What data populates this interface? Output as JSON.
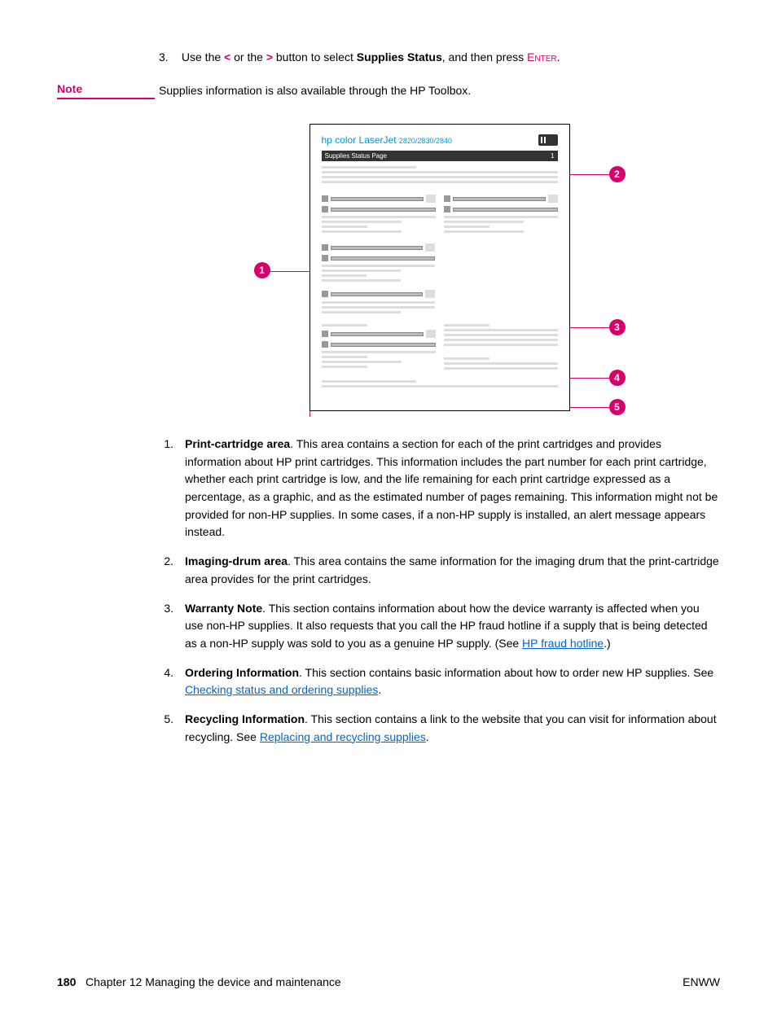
{
  "step": {
    "number": "3.",
    "pre": "Use the ",
    "lt": "<",
    "mid1": " or the ",
    "gt": ">",
    "mid2": " button to select ",
    "bold": "Supplies Status",
    "post": ", and then press ",
    "enter": "Enter",
    "dot": "."
  },
  "note": {
    "label": "Note",
    "text": "Supplies information is also available through the HP Toolbox."
  },
  "diagram": {
    "brand_hp": "hp color LaserJet",
    "model": "2820/2830/2840",
    "subhead_left": "Supplies Status Page",
    "subhead_right": "1"
  },
  "callouts": {
    "c1": "1",
    "c2": "2",
    "c3": "3",
    "c4": "4",
    "c5": "5"
  },
  "items": [
    {
      "num": "1.",
      "title": "Print-cartridge area",
      "body": ". This area contains a section for each of the print cartridges and provides information about HP print cartridges. This information includes the part number for each print cartridge, whether each print cartridge is low, and the life remaining for each print cartridge expressed as a percentage, as a graphic, and as the estimated number of pages remaining. This information might not be provided for non-HP supplies. In some cases, if a non-HP supply is installed, an alert message appears instead."
    },
    {
      "num": "2.",
      "title": "Imaging-drum area",
      "body": ". This area contains the same information for the imaging drum that the print-cartridge area provides for the print cartridges."
    },
    {
      "num": "3.",
      "title": "Warranty Note",
      "body_pre": ". This section contains information about how the device warranty is affected when you use non-HP supplies. It also requests that you call the HP fraud hotline if a supply that is being detected as a non-HP supply was sold to you as a genuine HP supply. (See ",
      "link": "HP fraud hotline",
      "body_post": ".)"
    },
    {
      "num": "4.",
      "title": "Ordering Information",
      "body_pre": ". This section contains basic information about how to order new HP supplies. See ",
      "link": "Checking status and ordering supplies",
      "body_post": "."
    },
    {
      "num": "5.",
      "title": "Recycling Information",
      "body_pre": ". This section contains a link to the website that you can visit for information about recycling. See ",
      "link": "Replacing and recycling supplies",
      "body_post": "."
    }
  ],
  "footer": {
    "page": "180",
    "chapter": "Chapter 12  Managing the device and maintenance",
    "lang": "ENWW"
  }
}
